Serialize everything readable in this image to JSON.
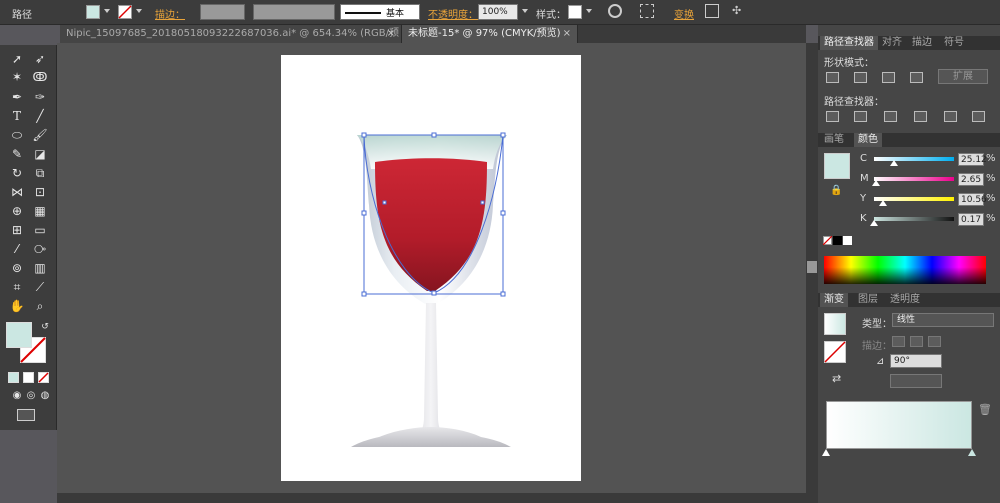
{
  "control_bar": {
    "mode_label": "路径",
    "stroke_label": "描边：",
    "stroke_profile_label": "基本",
    "opacity_label": "不透明度：",
    "opacity_value": "100%",
    "style_label": "样式：",
    "transform_label": "变换"
  },
  "tabs": [
    {
      "label": "Nipic_15097685_20180518093222687036.ai* @ 654.34% (RGB/预览)",
      "close": "×"
    },
    {
      "label": "未标题-15* @ 97% (CMYK/预览)",
      "close": "×"
    }
  ],
  "pathfinder": {
    "tabs": [
      "路径查找器",
      "对齐",
      "描边",
      "符号"
    ],
    "shape_modes_label": "形状模式：",
    "expand_label": "扩展",
    "pathfinders_label": "路径查找器："
  },
  "color_panel": {
    "tabs": [
      "画笔",
      "颜色"
    ],
    "channels": [
      {
        "name": "C",
        "value": "25.12",
        "unit": "%",
        "level": 0.25,
        "gradient": [
          "#ffffff",
          "#00aeef"
        ]
      },
      {
        "name": "M",
        "value": "2.65",
        "unit": "%",
        "level": 0.03,
        "gradient": [
          "#ffffff",
          "#ec008c"
        ]
      },
      {
        "name": "Y",
        "value": "10.56",
        "unit": "%",
        "level": 0.11,
        "gradient": [
          "#ffffff",
          "#fff200"
        ]
      },
      {
        "name": "K",
        "value": "0.17",
        "unit": "%",
        "level": 0.0,
        "gradient": [
          "#cce5e0",
          "#111111"
        ]
      }
    ],
    "swatch_color": "#cbe7e2"
  },
  "gradient_panel": {
    "tabs": [
      "渐变",
      "图层",
      "透明度"
    ],
    "type_label": "类型：",
    "type_value": "线性",
    "stroke_label": "描边：",
    "angle_value": "90°"
  },
  "colors": {
    "glass_fill": "#c9e4df",
    "wine": "#b51f2c",
    "selection": "#4a6cd4"
  },
  "icons": [
    "selection-icon",
    "direct-selection-icon",
    "magic-wand-icon",
    "lasso-icon",
    "pen-icon",
    "type-icon",
    "line-icon",
    "ellipse-icon",
    "paintbrush-icon",
    "pencil-icon",
    "rotate-icon",
    "scale-icon",
    "eyedropper-icon",
    "zoom-icon",
    "hand-icon"
  ]
}
